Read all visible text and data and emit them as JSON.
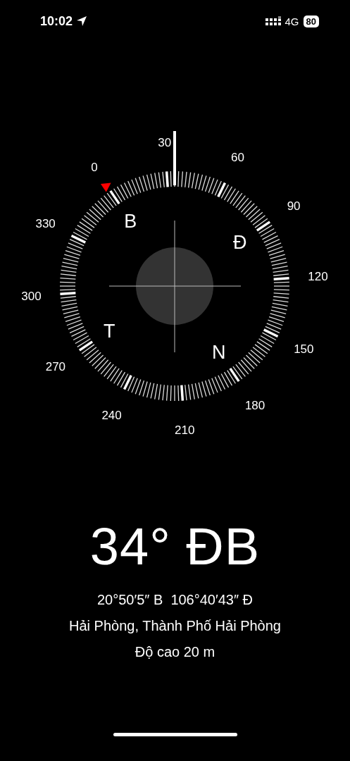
{
  "status_bar": {
    "time": "10:02",
    "network": "4G",
    "battery": "80"
  },
  "compass": {
    "degree_labels": [
      "0",
      "30",
      "60",
      "90",
      "120",
      "150",
      "180",
      "210",
      "240",
      "270",
      "300",
      "330"
    ],
    "cardinals": [
      "B",
      "Đ",
      "N",
      "T"
    ]
  },
  "heading": "34° ĐB",
  "coordinates": "20°50′5″ B  106°40′43″ Đ",
  "location": "Hải Phòng, Thành Phố Hải Phòng",
  "altitude": "Độ cao 20 m"
}
